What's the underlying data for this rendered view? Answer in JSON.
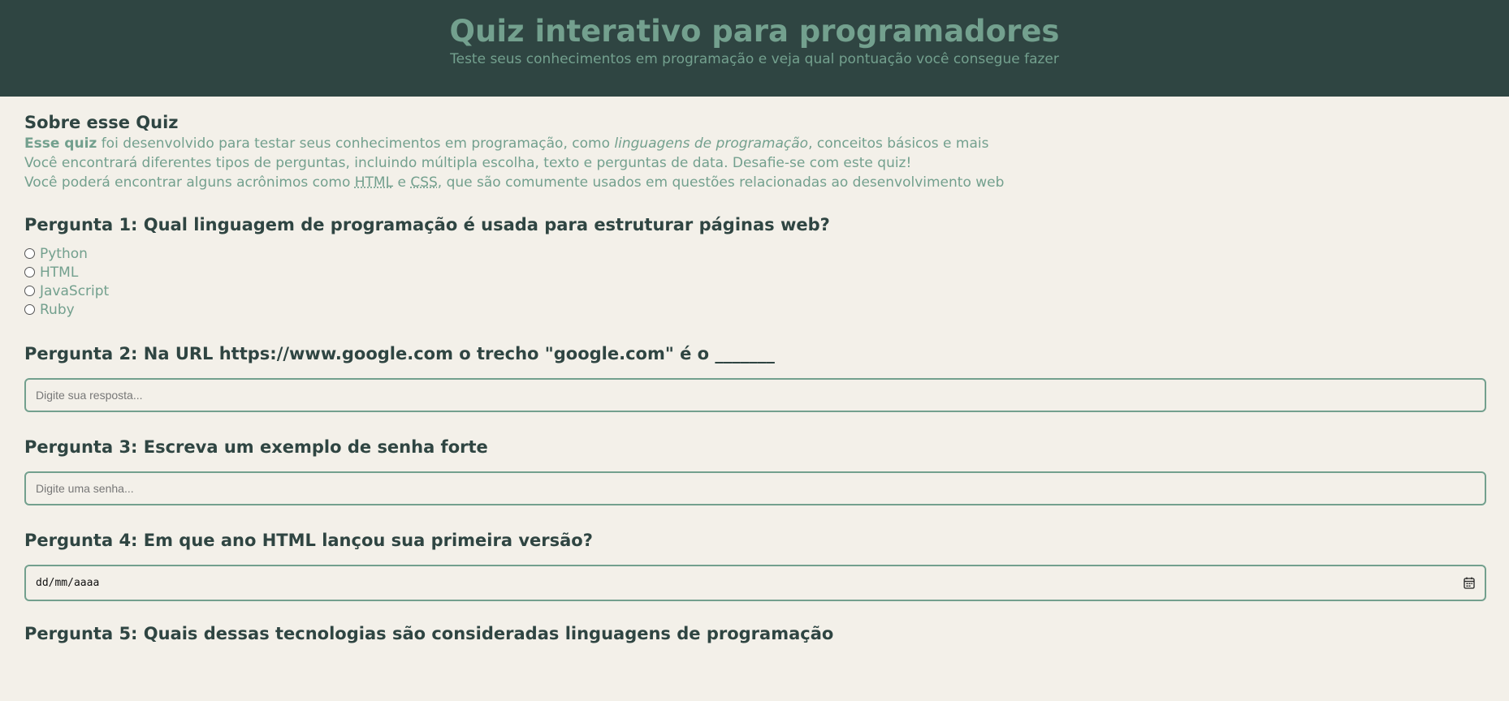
{
  "header": {
    "title": "Quiz interativo para programadores",
    "subtitle": "Teste seus conhecimentos em programação e veja qual pontuação você consegue fazer"
  },
  "about": {
    "title": "Sobre esse Quiz",
    "p1_bold": "Esse quiz",
    "p1_text_a": " foi desenvolvido para testar seus conhecimentos em programação, como ",
    "p1_italic": "linguagens de programação",
    "p1_text_b": ", conceitos básicos e mais",
    "p2": "Você encontrará diferentes tipos de perguntas, incluindo múltipla escolha, texto e perguntas de data. Desafie-se com este quiz!",
    "p3_a": "Você poderá encontrar alguns acrônimos como ",
    "p3_abbr1": "HTML",
    "p3_b": " e ",
    "p3_abbr2": "CSS",
    "p3_c": ", que são comumente usados em questões relacionadas ao desenvolvimento web"
  },
  "q1": {
    "title": "Pergunta 1: Qual linguagem de programação é usada para estruturar páginas web?",
    "options": [
      "Python",
      "HTML",
      "JavaScript",
      "Ruby"
    ]
  },
  "q2": {
    "title": "Pergunta 2: Na URL https://www.google.com o trecho \"google.com\" é o _______",
    "placeholder": "Digite sua resposta..."
  },
  "q3": {
    "title": "Pergunta 3: Escreva um exemplo de senha forte",
    "placeholder": "Digite uma senha..."
  },
  "q4": {
    "title": "Pergunta 4: Em que ano HTML lançou sua primeira versão?",
    "date_placeholder": "dd/mm/aaaa",
    "icon": "calendar-icon"
  },
  "q5": {
    "title": "Pergunta 5: Quais dessas tecnologias são consideradas linguagens de programação"
  },
  "colors": {
    "header_bg": "#2f4542",
    "accent": "#73a08e",
    "page_bg": "#f3f0e9",
    "heading": "#2f4542"
  }
}
